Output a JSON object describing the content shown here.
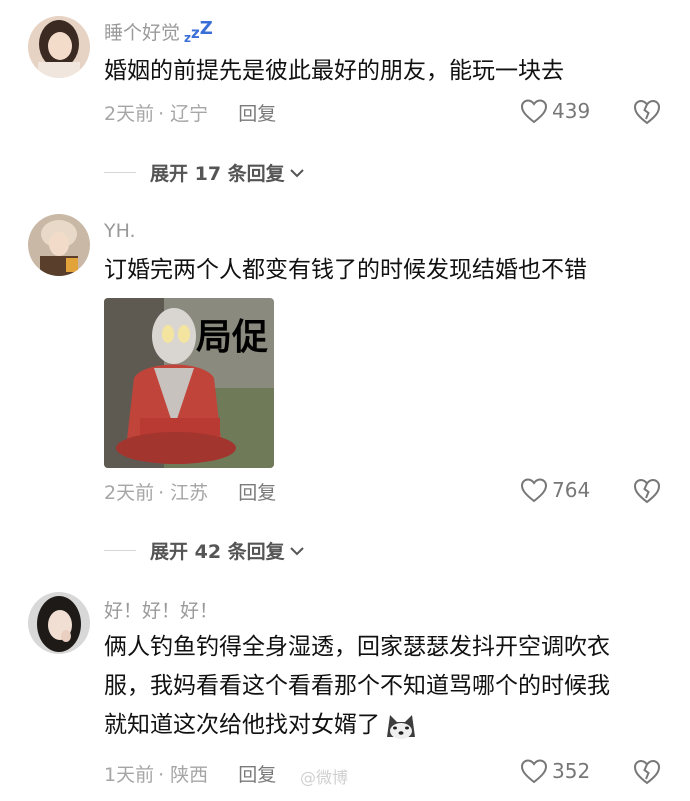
{
  "comments": [
    {
      "username": "睡个好觉",
      "username_badge": "ZZZ",
      "text": "婚姻的前提先是彼此最好的朋友，能玩一块去",
      "time": "2天前",
      "location": "· 辽宁",
      "reply_label": "回复",
      "likes": "439",
      "expand_label": "展开 17 条回复"
    },
    {
      "username": "YH.",
      "text": "订婚完两个人都变有钱了的时候发现结婚也不错",
      "meme_caption": "局促",
      "time": "2天前",
      "location": "· 江苏",
      "reply_label": "回复",
      "likes": "764",
      "expand_label": "展开 42 条回复"
    },
    {
      "username": "好！好！好！",
      "text_lines": [
        "俩人钓鱼钓得全身湿透，回家瑟瑟发抖开空调吹衣",
        "服，我妈看看这个看看那个不知道骂哪个的时候我",
        "就知道这次给他找对女婿了"
      ],
      "time": "1天前",
      "location": "· 陕西",
      "reply_label": "回复",
      "likes": "352"
    }
  ],
  "watermark": "@微博"
}
